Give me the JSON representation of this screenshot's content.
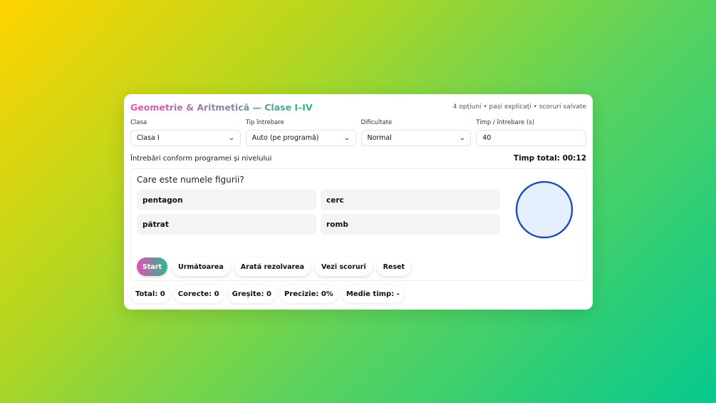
{
  "header": {
    "title": "Geometrie & Aritmetică — Clase I–IV",
    "subtitle": "4 opțiuni • pași explicați • scoruri salvate"
  },
  "controls": {
    "grade_label": "Clasa",
    "grade_value": "Clasa I",
    "type_label": "Tip întrebare",
    "type_value": "Auto (pe programă)",
    "difficulty_label": "Dificultate",
    "difficulty_value": "Normal",
    "time_label": "Timp / întrebare (s)",
    "time_value": "40"
  },
  "info": {
    "description": "Întrebări conform programei și nivelului",
    "total_time": "Timp total: 00:12"
  },
  "quiz": {
    "question": "Care este numele figurii?",
    "options": [
      "pentagon",
      "cerc",
      "pătrat",
      "romb"
    ],
    "shape": {
      "kind": "circle",
      "fill": "#e6efff",
      "stroke": "#1f4fb0"
    }
  },
  "buttons": {
    "start": "Start",
    "next": "Următoarea",
    "solution": "Arată rezolvarea",
    "scores": "Vezi scoruri",
    "reset": "Reset"
  },
  "stats": {
    "total": "Total: 0",
    "correct": "Corecte: 0",
    "wrong": "Greșite: 0",
    "accuracy": "Precizie: 0%",
    "avg_time": "Medie timp: -"
  },
  "colors": {
    "accent_pink": "#e14fb4",
    "accent_green": "#22b98b"
  }
}
